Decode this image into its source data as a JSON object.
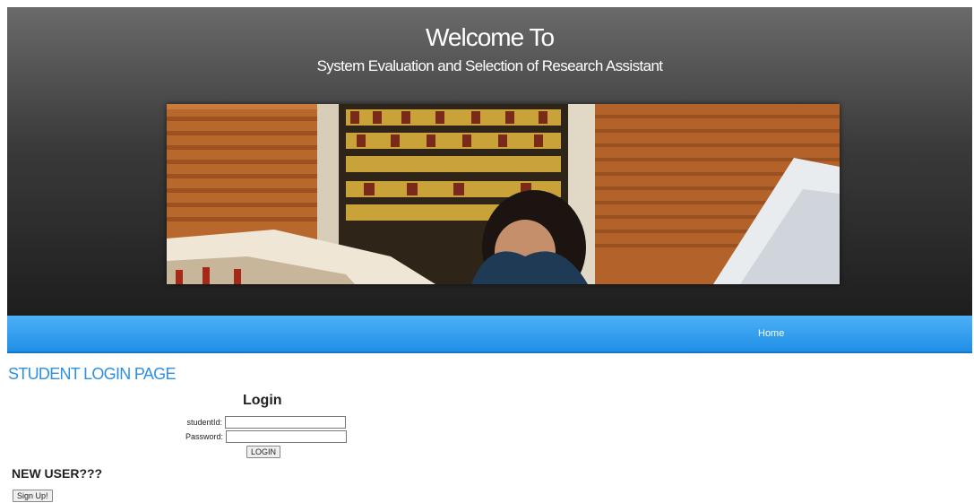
{
  "header": {
    "title": "Welcome To",
    "subtitle": "System Evaluation and Selection of Research Assistant"
  },
  "nav": {
    "home_label": "Home"
  },
  "page": {
    "heading": "STUDENT LOGIN PAGE"
  },
  "login_form": {
    "heading": "Login",
    "student_id_label": "studentId:",
    "student_id_value": "",
    "password_label": "Password:",
    "password_value": "",
    "login_button": "LOGIN"
  },
  "signup": {
    "heading": "NEW USER???",
    "button": "Sign Up!"
  },
  "colors": {
    "nav_blue": "#2f9cf0",
    "heading_blue": "#2f8fe0",
    "header_dark": "#2a2a2a"
  }
}
